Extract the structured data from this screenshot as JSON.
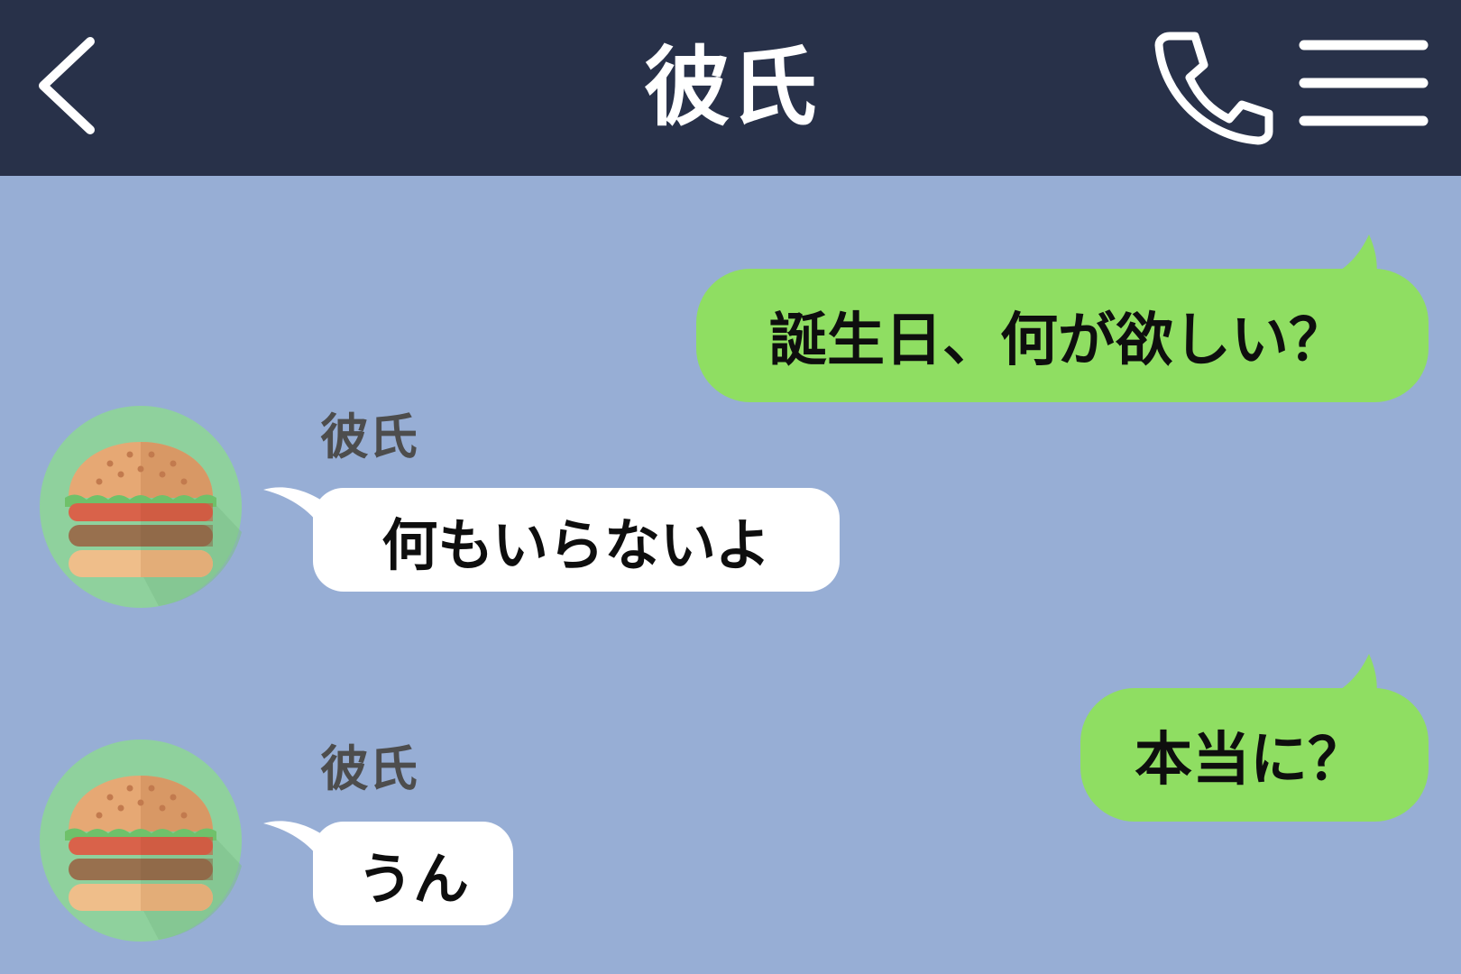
{
  "header": {
    "title": "彼氏",
    "back_icon": "chevron-left-icon",
    "call_icon": "phone-icon",
    "menu_icon": "menu-icon",
    "background_color": "#283149"
  },
  "chat": {
    "background_color": "#97aed5",
    "outgoing_bubble_color": "#8fde62",
    "incoming_bubble_color": "#ffffff",
    "messages": [
      {
        "direction": "outgoing",
        "text": "誕生日、何が欲しい？"
      },
      {
        "direction": "incoming",
        "sender": "彼氏",
        "avatar": "hamburger-icon",
        "text": "何もいらないよ"
      },
      {
        "direction": "outgoing",
        "text": "本当に？"
      },
      {
        "direction": "incoming",
        "sender": "彼氏",
        "avatar": "hamburger-icon",
        "text": "うん"
      }
    ]
  }
}
